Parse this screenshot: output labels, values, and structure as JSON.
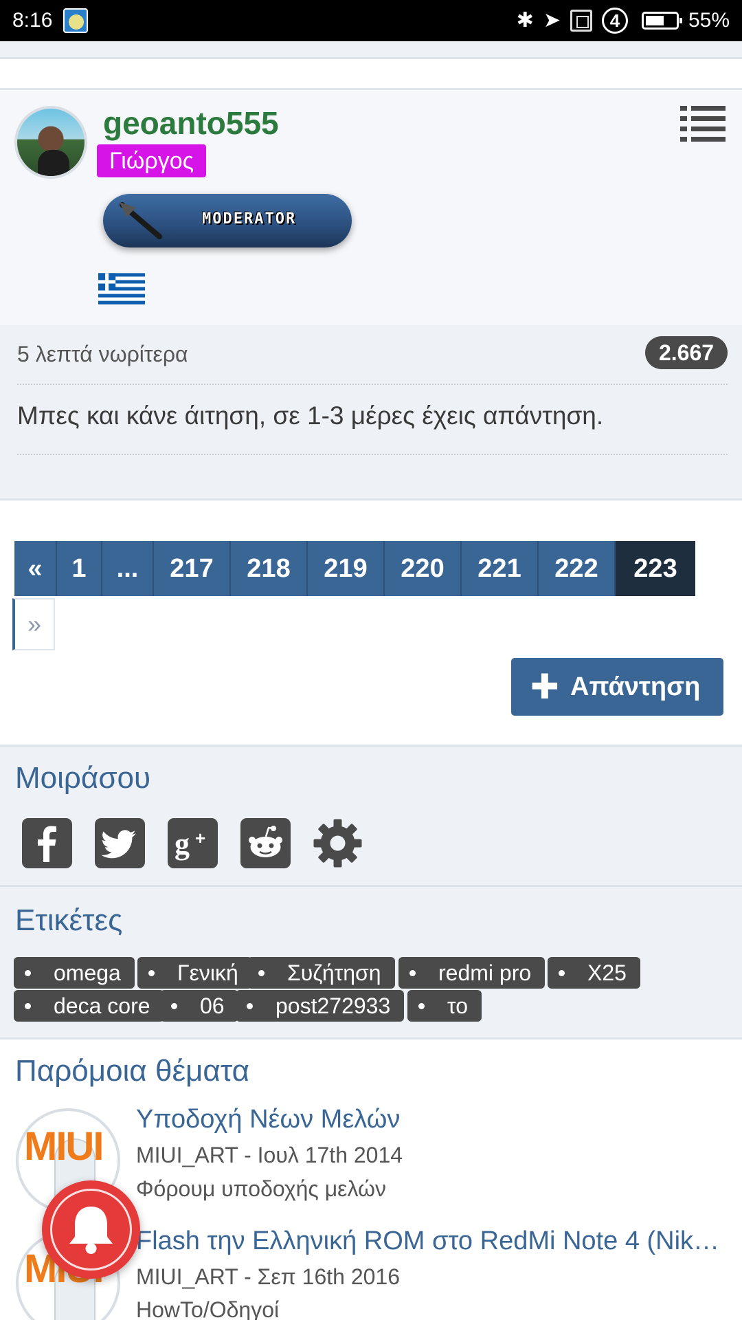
{
  "status_bar": {
    "time": "8:16",
    "battery": "55%"
  },
  "post": {
    "username": "geoanto555",
    "user_title": "Γιώργος",
    "badge": "MODERATOR",
    "time_ago": "5 λεπτά νωρίτερα",
    "post_count": "2.667",
    "text": "Μπες και κάνε άιτηση, σε 1-3 μέρες έχεις απάντηση."
  },
  "pagination": {
    "first": "«",
    "next": "»",
    "pages": [
      "1",
      "...",
      "217",
      "218",
      "219",
      "220",
      "221",
      "222",
      "223"
    ],
    "current": "223"
  },
  "reply_button": {
    "label": "Απάντηση"
  },
  "share": {
    "title": "Μοιράσου",
    "icons": [
      "facebook-icon",
      "twitter-icon",
      "google-plus-icon",
      "reddit-icon",
      "gear-icon"
    ]
  },
  "tags": {
    "title": "Ετικέτες",
    "items": [
      "omega",
      "Γενική",
      "Συζήτηση",
      "redmi pro",
      "X25",
      "deca core",
      "06",
      "post272933",
      "το"
    ]
  },
  "similar": {
    "title": "Παρόμοια θέματα",
    "threads": [
      {
        "title": "Υποδοχή Νέων Μελών",
        "meta": "MIUI_ART - Ιουλ 17th 2014",
        "forum": "Φόρουμ υποδοχής μελών",
        "avatar": "MIUI"
      },
      {
        "title": "Flash την Ελληνική ROM στο RedMi Note 4 (Nik…",
        "meta": "MIUI_ART - Σεπ 16th 2016",
        "forum": "HowTo/Οδηγοί",
        "avatar": "MIUI"
      }
    ]
  },
  "colors": {
    "accent": "#3a6696",
    "username": "#2c7a3e",
    "user_title_bg": "#d714e8",
    "notification": "#e53a3a"
  }
}
